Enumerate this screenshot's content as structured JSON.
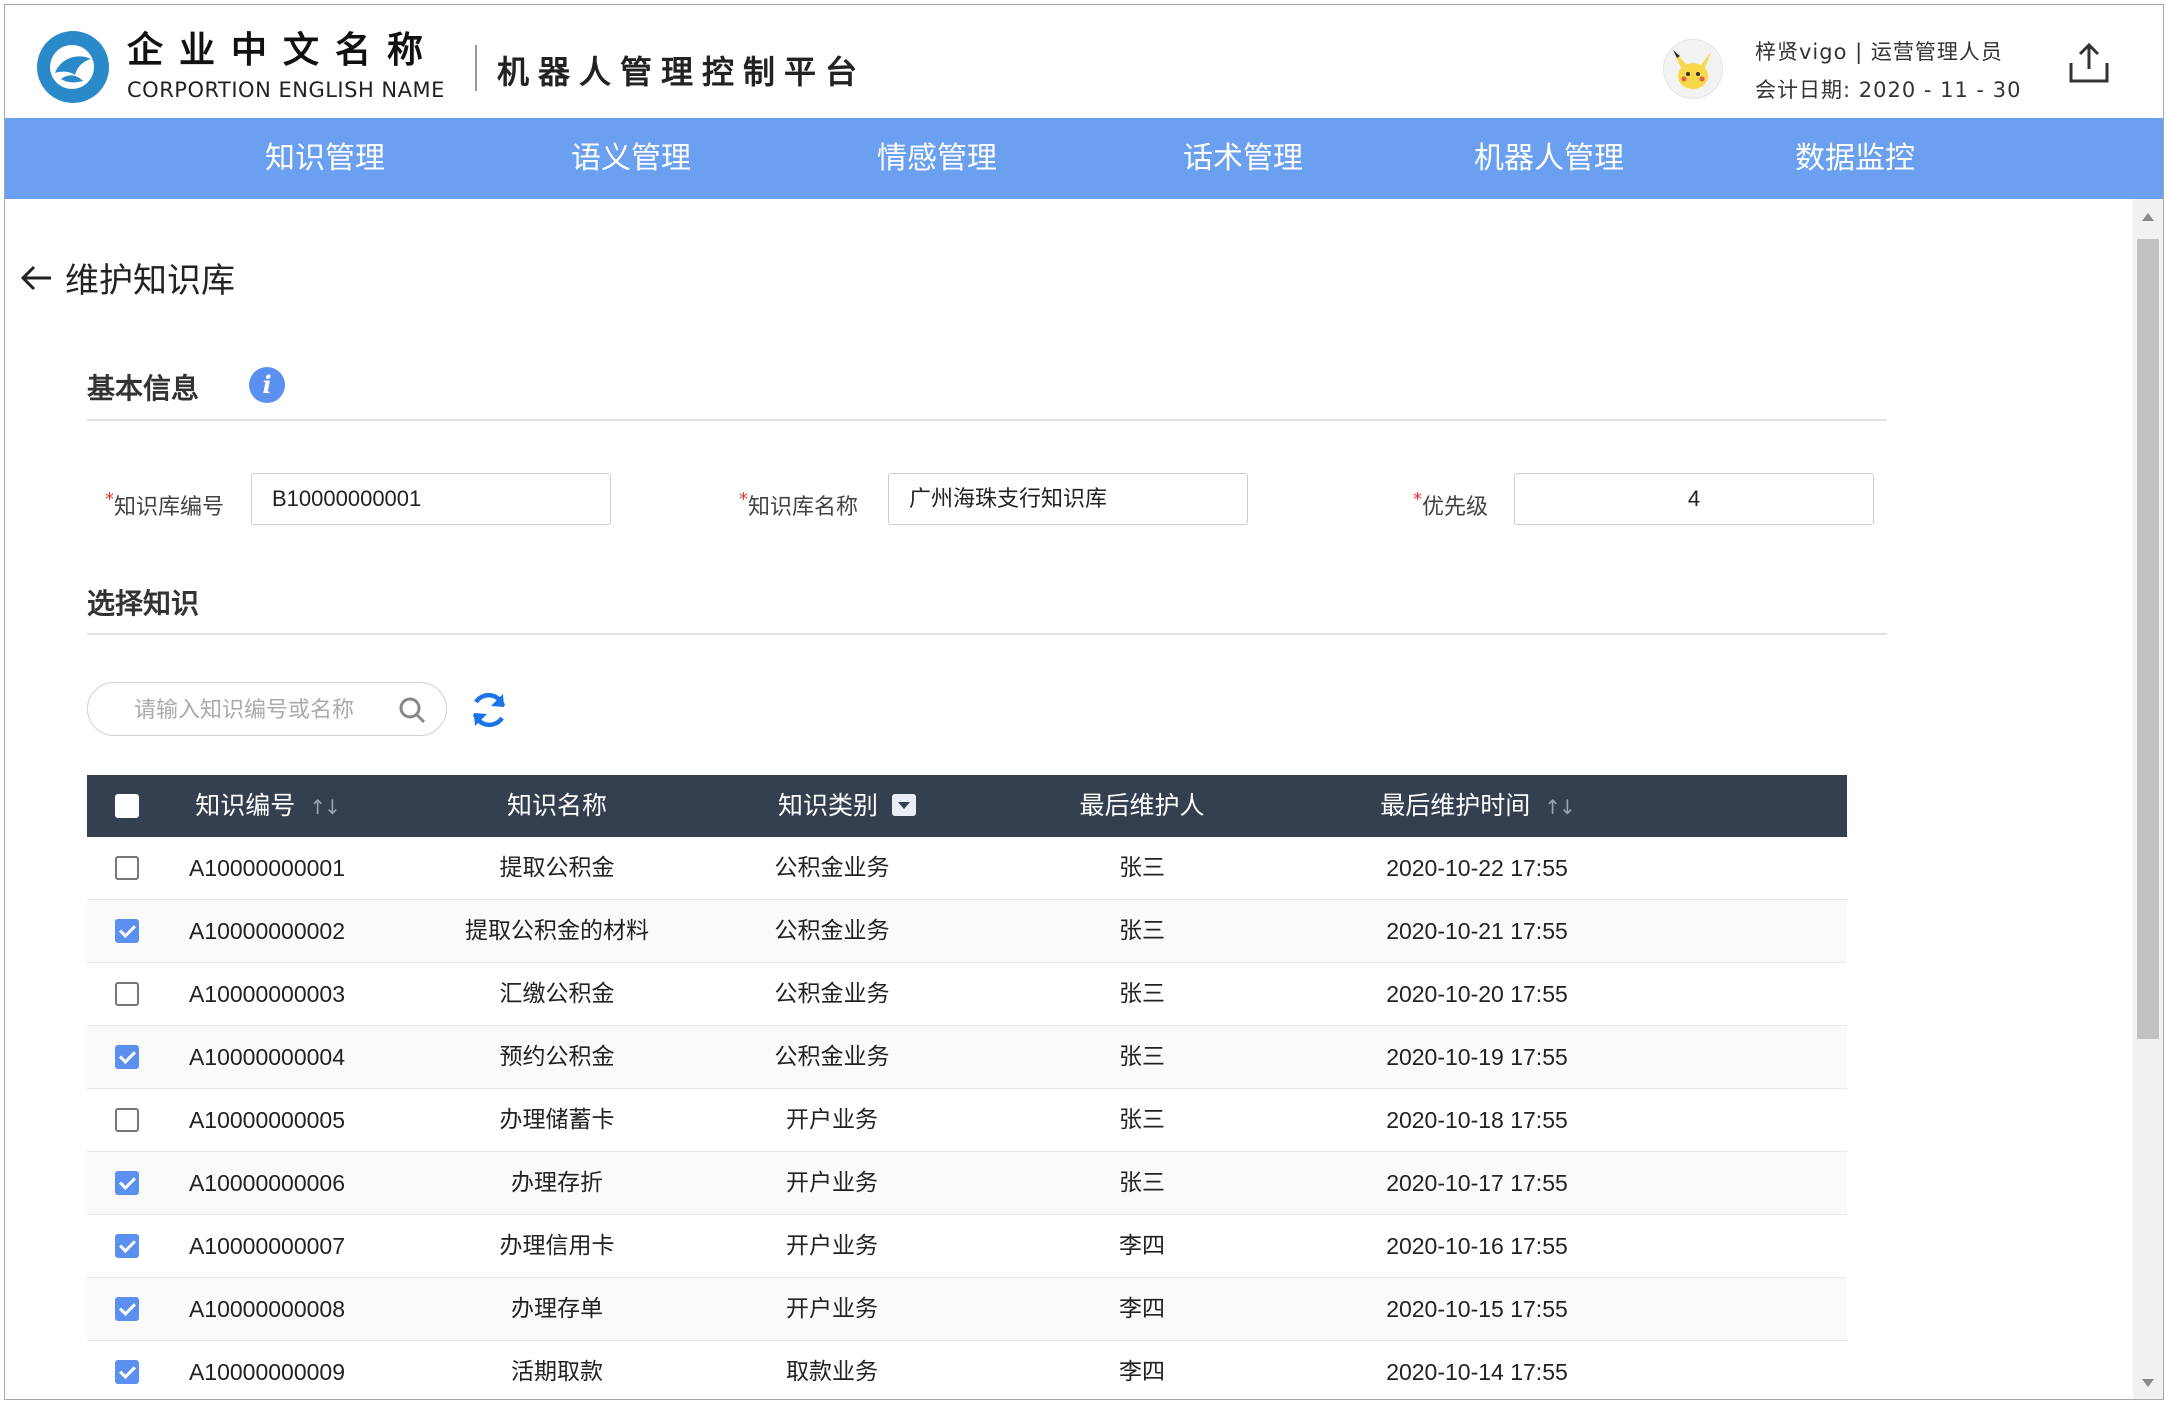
{
  "header": {
    "company_cn": "企业中文名称",
    "company_en": "CORPORTION ENGLISH NAME",
    "platform_title": "机器人管理控制平台",
    "user_line": "梓贤vigo | 运营管理人员",
    "date_line": "会计日期:  2020 - 11 - 30"
  },
  "nav": {
    "items": [
      "知识管理",
      "语义管理",
      "情感管理",
      "话术管理",
      "机器人管理",
      "数据监控"
    ]
  },
  "page": {
    "back_title": "维护知识库"
  },
  "basic_info": {
    "title": "基本信息",
    "info_icon": "i",
    "fields": {
      "kb_id_label": "知识库编号",
      "kb_id_value": "B10000000001",
      "kb_name_label": "知识库名称",
      "kb_name_value": "广州海珠支行知识库",
      "priority_label": "优先级",
      "priority_value": "4",
      "required_mark": "*"
    }
  },
  "select_knowledge": {
    "title": "选择知识",
    "search_placeholder": "请输入知识编号或名称"
  },
  "table": {
    "headers": {
      "id": "知识编号",
      "name": "知识名称",
      "category": "知识类别",
      "maintainer": "最后维护人",
      "time": "最后维护时间",
      "sort_glyph": "↑↓"
    },
    "select_all_checked": false,
    "rows": [
      {
        "id": "A10000000001",
        "name": "提取公积金",
        "category": "公积金业务",
        "maintainer": "张三",
        "time": "2020-10-22 17:55",
        "checked": false
      },
      {
        "id": "A10000000002",
        "name": "提取公积金的材料",
        "category": "公积金业务",
        "maintainer": "张三",
        "time": "2020-10-21 17:55",
        "checked": true
      },
      {
        "id": "A10000000003",
        "name": "汇缴公积金",
        "category": "公积金业务",
        "maintainer": "张三",
        "time": "2020-10-20 17:55",
        "checked": false
      },
      {
        "id": "A10000000004",
        "name": "预约公积金",
        "category": "公积金业务",
        "maintainer": "张三",
        "time": "2020-10-19 17:55",
        "checked": true
      },
      {
        "id": "A10000000005",
        "name": "办理储蓄卡",
        "category": "开户业务",
        "maintainer": "张三",
        "time": "2020-10-18 17:55",
        "checked": false
      },
      {
        "id": "A10000000006",
        "name": "办理存折",
        "category": "开户业务",
        "maintainer": "张三",
        "time": "2020-10-17 17:55",
        "checked": true
      },
      {
        "id": "A10000000007",
        "name": "办理信用卡",
        "category": "开户业务",
        "maintainer": "李四",
        "time": "2020-10-16 17:55",
        "checked": true
      },
      {
        "id": "A10000000008",
        "name": "办理存单",
        "category": "开户业务",
        "maintainer": "李四",
        "time": "2020-10-15 17:55",
        "checked": true
      },
      {
        "id": "A10000000009",
        "name": "活期取款",
        "category": "取款业务",
        "maintainer": "李四",
        "time": "2020-10-14 17:55",
        "checked": true
      }
    ]
  },
  "colors": {
    "nav_bg": "#6aa0ef",
    "table_header_bg": "#344050",
    "accent": "#5b8ff0",
    "logo": "#2a89c9"
  },
  "icons": {
    "logo": "company-logo",
    "avatar": "user-avatar",
    "upload": "upload-icon",
    "back": "back-arrow-icon",
    "info": "info-icon",
    "search": "search-icon",
    "refresh": "refresh-icon",
    "dropdown": "dropdown-icon"
  }
}
